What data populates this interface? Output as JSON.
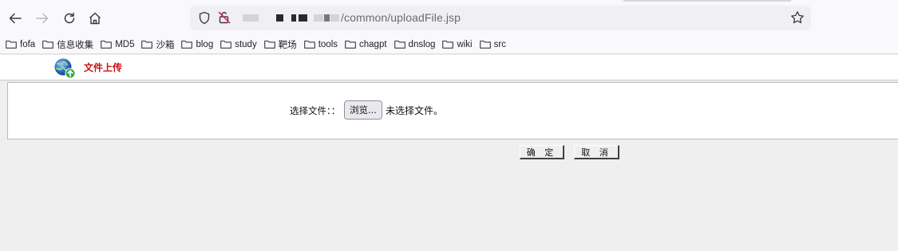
{
  "browser": {
    "url_path": "/common/uploadFile.jsp",
    "bookmarks": [
      {
        "label": "fofa"
      },
      {
        "label": "信息收集"
      },
      {
        "label": "MD5"
      },
      {
        "label": "沙箱"
      },
      {
        "label": "blog"
      },
      {
        "label": "study"
      },
      {
        "label": "靶场"
      },
      {
        "label": "tools"
      },
      {
        "label": "chagpt"
      },
      {
        "label": "dnslog"
      },
      {
        "label": "wiki"
      },
      {
        "label": "src"
      }
    ]
  },
  "page": {
    "title": "文件上传",
    "file_label": "选择文件：：",
    "browse_label": "浏览...",
    "file_status": "未选择文件。",
    "ok_label": "确 定",
    "cancel_label": "取 消"
  },
  "colors": {
    "title_red": "#cc1111",
    "page_bg": "#efefef"
  }
}
